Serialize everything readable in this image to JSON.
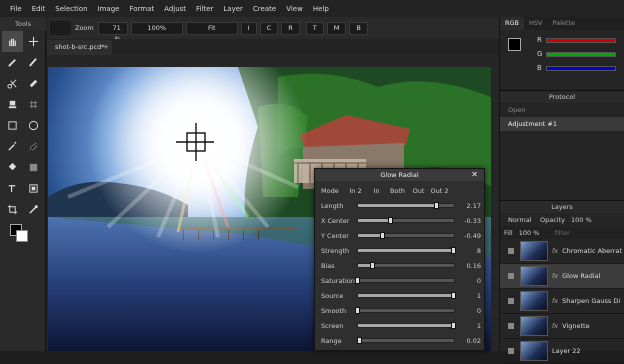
{
  "menu": [
    "File",
    "Edit",
    "Selection",
    "Image",
    "Format",
    "Adjust",
    "Filter",
    "Layer",
    "Create",
    "View",
    "Help"
  ],
  "tools_header": "Tools",
  "tools": [
    "hand-icon",
    "move-icon",
    "pencil-icon",
    "brush-icon",
    "scissors-icon",
    "healing-icon",
    "stamp-icon",
    "grid-icon",
    "rect-select-icon",
    "ellipse-select-icon",
    "magic-wand-icon",
    "lasso-icon",
    "bucket-icon",
    "gradient-icon",
    "text-icon",
    "transform-icon",
    "crop-icon",
    "eyedropper-icon"
  ],
  "options": {
    "zoom_label": "Zoom",
    "zoom_value": "71 %",
    "value2": "100%",
    "fit": "Fit",
    "i": "I",
    "c": "C",
    "r": "R",
    "t": "T",
    "m": "M",
    "b": "B"
  },
  "tab": {
    "filename": "shot-b-src.pcd*",
    "add": "+"
  },
  "right": {
    "tabs": [
      "RGB",
      "HSV",
      "Palette"
    ],
    "colors": {
      "r": "#e01010",
      "g": "#10c010",
      "b": "#2020e0"
    },
    "channels": [
      "R",
      "G",
      "B"
    ],
    "protocol_title": "Protocol",
    "history": [
      "Open",
      "Adjustment #1"
    ],
    "layers_title": "Layers",
    "blend": "Normal",
    "opacity_label": "Opacity",
    "opacity_value": "100 %",
    "fill_label": "Fill",
    "fill_value": "100 %",
    "filter_label": "filter",
    "layers": [
      "Chromatic Aberrat",
      "Glow Radial",
      "Sharpen Gauss Di",
      "Vignette",
      "Layer 22"
    ],
    "fx": "fx"
  },
  "dialog": {
    "title": "Glow Radial",
    "close": "✕",
    "mode_label": "Mode",
    "modes": [
      "In 2",
      "In",
      "Both",
      "Out",
      "Out 2"
    ],
    "params": [
      {
        "label": "Length",
        "value": "2.17",
        "fraction": 0.82
      },
      {
        "label": "X Center",
        "value": "-0.33",
        "fraction": 0.34
      },
      {
        "label": "Y Center",
        "value": "-0.49",
        "fraction": 0.26
      },
      {
        "label": "Strength",
        "value": "8",
        "fraction": 1.0
      },
      {
        "label": "Bias",
        "value": "0.16",
        "fraction": 0.16
      },
      {
        "label": "Saturation",
        "value": "0",
        "fraction": 0.0
      },
      {
        "label": "Source",
        "value": "1",
        "fraction": 1.0
      },
      {
        "label": "Smooth",
        "value": "0",
        "fraction": 0.0
      },
      {
        "label": "Screen",
        "value": "1",
        "fraction": 1.0
      },
      {
        "label": "Range",
        "value": "0.02",
        "fraction": 0.02
      }
    ]
  }
}
